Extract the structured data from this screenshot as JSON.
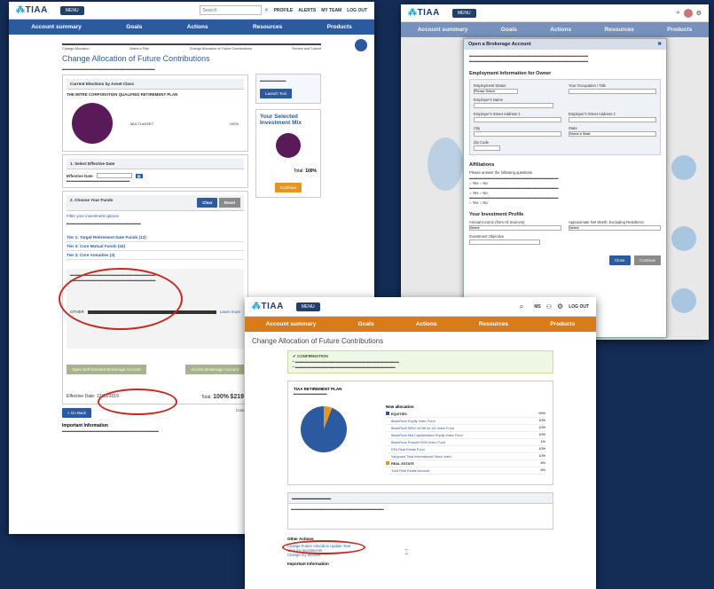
{
  "shot1": {
    "logo": "TIAA",
    "menu": "MENU",
    "search_placeholder": "Search",
    "utilities": [
      "PROFILE",
      "ALERTS",
      "MY TEAM",
      "LOG OUT"
    ],
    "nav": [
      "Account summary",
      "Goals",
      "Actions",
      "Resources",
      "Products"
    ],
    "steps": [
      "Change Allocation",
      "Select a Plan",
      "Change Allocation of Future Contributions",
      "Review and Submit"
    ],
    "title": "Change Allocation of Future Contributions",
    "current_election_label": "Current Elections by Asset Class",
    "plan_name": "THE MITRE CORPORATION QUALIFIED RETIREMENT PLAN",
    "multi_asset": "MULTI-ASSET",
    "multi_asset_pct": "100%",
    "promo_btn": "Launch Tool",
    "selected_mix_title": "Your Selected Investment Mix",
    "total_label": "Total:",
    "total_value": "100%",
    "continue_btn": "Continue",
    "select_date": "1. Select Effective Date",
    "effective_date_label": "Effective Date",
    "choose_funds": "2. Choose Your Funds",
    "clear_btn": "Clear",
    "reset_btn": "Reset",
    "filter_label": "Filter your investment options",
    "tiers": [
      "Tier 1: Target Retirement Date Funds (12)",
      "Tier 2: Core Mutual Funds (16)",
      "Tier 3: Core Annuities (3)"
    ],
    "other": "OTHER",
    "learn_more": "Learn more",
    "brokerage_btn": "Open Self-Directed Brokerage Account",
    "access_btn": "Access Brokerage Account",
    "effective_footer": "Effective Date: 12/10/2019",
    "footer_total": "Total:",
    "footer_pct": "100%",
    "footer_amount": "$219",
    "back": "« Go Back",
    "cancel": "Cancel",
    "important": "Important Information"
  },
  "shot2": {
    "logo": "TIAA",
    "menu": "MENU",
    "nav": [
      "Account summary",
      "Goals",
      "Actions",
      "Resources",
      "Products"
    ],
    "modal_title": "Open a Brokerage Account",
    "employment_head": "Employment Information for Owner",
    "fields": [
      "Employment Status",
      "Your Occupation / Title",
      "Employer's Name",
      "Employer's Street Address 1",
      "Employer's Street Address 2",
      "City",
      "State",
      "Zip Code"
    ],
    "please_select": "Please Select",
    "select_state": "Select a State",
    "affiliations_head": "Affiliations",
    "affiliations_q": "Please answer the following questions",
    "yes": "Yes",
    "no": "No",
    "investment_head": "Your Investment Profile",
    "income_label": "Annual Income (from All Sources)",
    "networth_label": "Approximate Net Worth, Excluding Residence",
    "objective_label": "Investment Objective",
    "select": "Select",
    "close_btn": "Close",
    "continue_btn": "Continue"
  },
  "shot3": {
    "logo": "TIAA",
    "menu": "MENU",
    "utilities": [
      "MS",
      "LOG OUT"
    ],
    "nav": [
      "Account summary",
      "Goals",
      "Actions",
      "Resources",
      "Products"
    ],
    "title": "Change Allocation of Future Contributions",
    "confirm_head": "CONFIRMATION",
    "plan_line": "TIAA RETIREMENT PLAN",
    "new_allocation": "New allocation",
    "funds": [
      {
        "name": "EQUITIES",
        "pct": "94%",
        "color": "#2c5aa0"
      },
      {
        "name": "BlackRock Equity Index Fund",
        "pct": "10%",
        "color": ""
      },
      {
        "name": "BlackRock MSCI ACWI ex-US Index Fund",
        "pct": "10%",
        "color": ""
      },
      {
        "name": "BlackRock Mid Capitalization Equity Index Fund",
        "pct": "10%",
        "color": ""
      },
      {
        "name": "BlackRock Russell 2000 Index Fund",
        "pct": "1%",
        "color": ""
      },
      {
        "name": "DFA Real Estate Fund",
        "pct": "10%",
        "color": ""
      },
      {
        "name": "Vanguard Total International Stock Index",
        "pct": "10%",
        "color": ""
      },
      {
        "name": "REAL ESTATE",
        "pct": "6%",
        "color": "#e6951e"
      },
      {
        "name": "TIAA Real Estate Account",
        "pct": "6%",
        "color": ""
      }
    ],
    "other_actions": "Other Actions",
    "link_change": "Change Future Allocation Update Year",
    "link_other1": "View my investments",
    "link_other2": "Change my account",
    "important": "Important Information"
  }
}
